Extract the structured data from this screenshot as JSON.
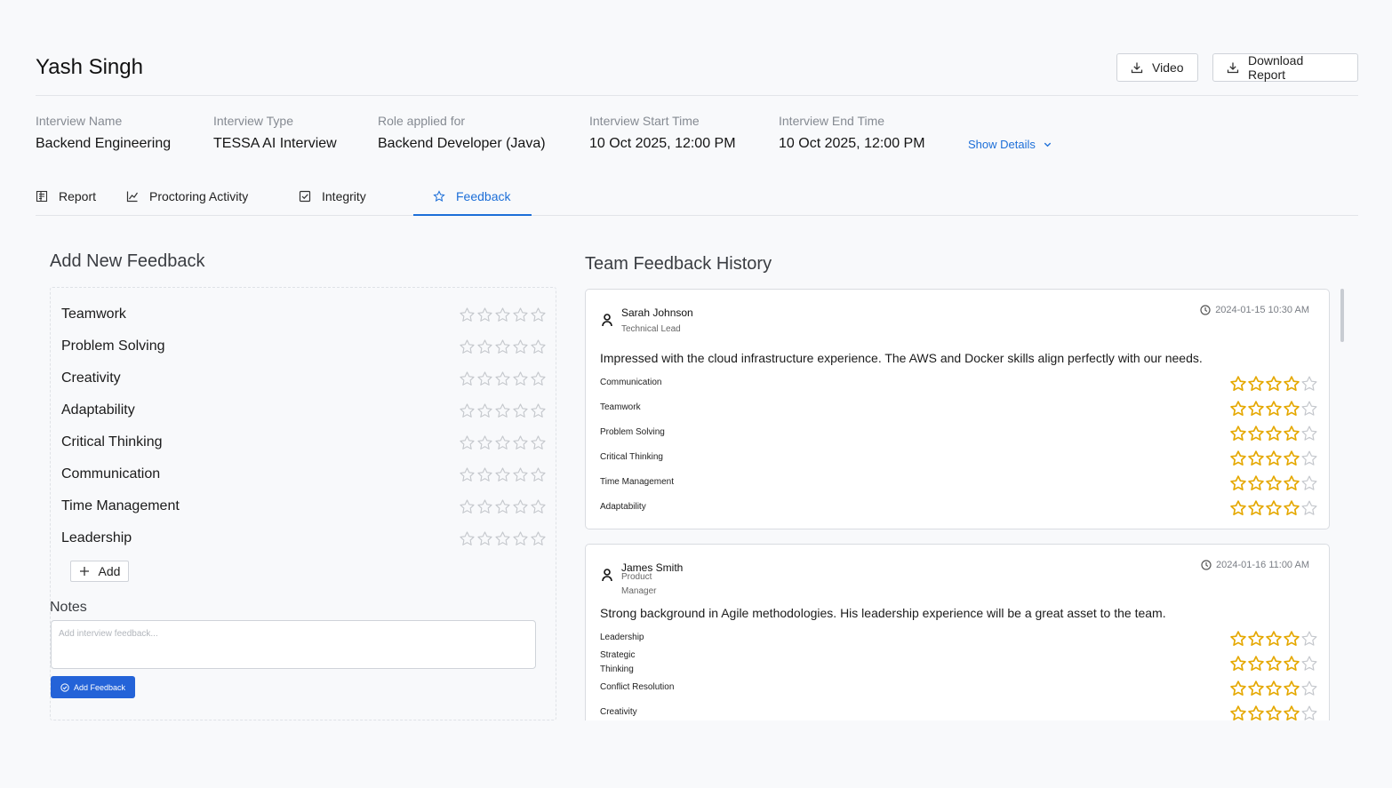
{
  "header": {
    "candidate_name": "Yash Singh",
    "video_label": "Video",
    "download_report_label": "Download Report"
  },
  "meta": [
    {
      "label": "Interview Name",
      "value": "Backend Engineering"
    },
    {
      "label": "Interview Type",
      "value": "TESSA AI Interview"
    },
    {
      "label": "Role applied for",
      "value": "Backend Developer (Java)"
    },
    {
      "label": "Interview Start Time",
      "value": "10 Oct 2025, 12:00 PM"
    },
    {
      "label": "Interview End Time",
      "value": "10 Oct 2025, 12:00 PM"
    }
  ],
  "show_details_label": "Show Details",
  "tabs": [
    {
      "label": "Report",
      "icon": "report-icon"
    },
    {
      "label": "Proctoring Activity",
      "icon": "chart-line-icon"
    },
    {
      "label": "Integrity",
      "icon": "checkbox-icon"
    },
    {
      "label": "Feedback",
      "icon": "star-icon",
      "active": true
    }
  ],
  "add_feedback": {
    "title": "Add New Feedback",
    "criteria": [
      {
        "label": "Teamwork",
        "rating": 0
      },
      {
        "label": "Problem Solving",
        "rating": 0
      },
      {
        "label": "Creativity",
        "rating": 0
      },
      {
        "label": "Adaptability",
        "rating": 0
      },
      {
        "label": "Critical Thinking",
        "rating": 0
      },
      {
        "label": "Communication",
        "rating": 0
      },
      {
        "label": "Time Management",
        "rating": 0
      },
      {
        "label": "Leadership",
        "rating": 0
      }
    ],
    "add_label": "Add",
    "notes_label": "Notes",
    "notes_placeholder": "Add interview feedback...",
    "notes_value": "",
    "submit_label": "Add Feedback"
  },
  "history": {
    "title": "Team Feedback History",
    "entries": [
      {
        "reviewer": "Sarah Johnson",
        "role_lines": [
          "Technical Lead"
        ],
        "timestamp": "2024-01-15 10:30 AM",
        "comment": "Impressed with the cloud infrastructure experience. The AWS and Docker skills align perfectly with our needs.",
        "ratings": [
          {
            "label_lines": [
              "Communication"
            ],
            "rating": 4
          },
          {
            "label_lines": [
              "Teamwork"
            ],
            "rating": 4
          },
          {
            "label_lines": [
              "Problem Solving"
            ],
            "rating": 4
          },
          {
            "label_lines": [
              "Critical Thinking"
            ],
            "rating": 4
          },
          {
            "label_lines": [
              "Time Management"
            ],
            "rating": 4
          },
          {
            "label_lines": [
              "Adaptability"
            ],
            "rating": 4
          }
        ]
      },
      {
        "reviewer": "James Smith",
        "role_lines": [
          "Product",
          "Manager"
        ],
        "timestamp": "2024-01-16 11:00 AM",
        "comment": "Strong background in Agile methodologies. His leadership experience will be a great asset to the team.",
        "ratings": [
          {
            "label_lines": [
              "Leadership"
            ],
            "rating": 4
          },
          {
            "label_lines": [
              "Strategic",
              "Thinking"
            ],
            "rating": 4
          },
          {
            "label_lines": [
              "Conflict Resolution"
            ],
            "rating": 4
          },
          {
            "label_lines": [
              "Creativity"
            ],
            "rating": 4
          }
        ]
      }
    ]
  },
  "colors": {
    "accent": "#1d6fd8",
    "primary_button": "#2463d8",
    "star_filled": "#e5a800",
    "star_empty": "#c4c7cc"
  }
}
